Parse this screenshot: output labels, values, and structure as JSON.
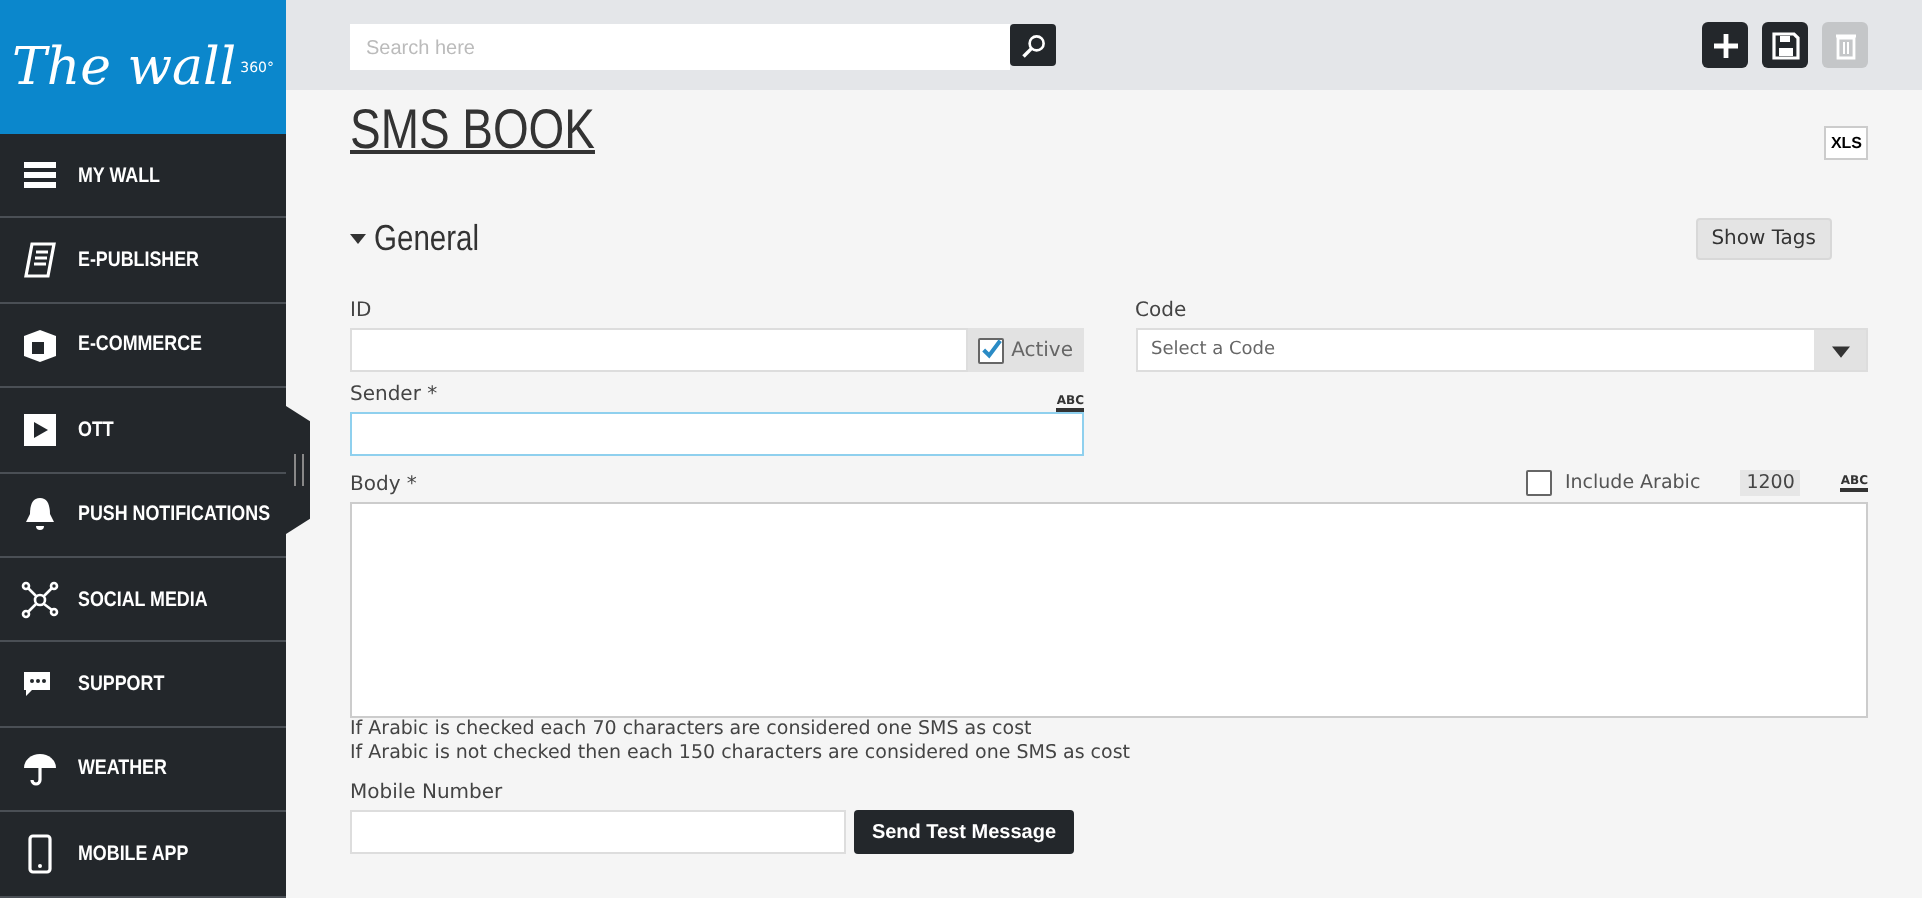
{
  "logo": {
    "text": "The wall",
    "sup": "360°"
  },
  "sidebar": {
    "items": [
      {
        "label": "MY WALL"
      },
      {
        "label": "E-PUBLISHER"
      },
      {
        "label": "E-COMMERCE"
      },
      {
        "label": "OTT"
      },
      {
        "label": "PUSH NOTIFICATIONS"
      },
      {
        "label": "SOCIAL MEDIA"
      },
      {
        "label": "SUPPORT"
      },
      {
        "label": "WEATHER"
      },
      {
        "label": "MOBILE APP"
      }
    ]
  },
  "toolbar": {
    "search": {
      "placeholder": "Search here"
    },
    "buttons": [
      {
        "kind": "add",
        "disabled": false
      },
      {
        "kind": "save",
        "disabled": false
      },
      {
        "kind": "delete",
        "disabled": true
      }
    ]
  },
  "page": {
    "title": "SMS BOOK",
    "export": "XLS"
  },
  "section": {
    "title": "General",
    "expanded": true,
    "show_tags": "Show Tags"
  },
  "form": {
    "id_label": "ID",
    "active": {
      "label": "Active",
      "checked": true
    },
    "code_label": "Code",
    "code_placeholder": "Select a Code",
    "sender_label": "Sender *",
    "spell": "ABC",
    "body_label": "Body *",
    "include_arabic": {
      "label": "Include Arabic",
      "checked": false
    },
    "counter": "1200",
    "body_spell": "ABC",
    "notes": [
      "If Arabic is checked each 70 characters are considered one SMS as cost",
      "If Arabic is not checked then each 150 characters are considered one SMS as cost"
    ],
    "mobile_label": "Mobile Number",
    "send": "Send Test Message"
  }
}
